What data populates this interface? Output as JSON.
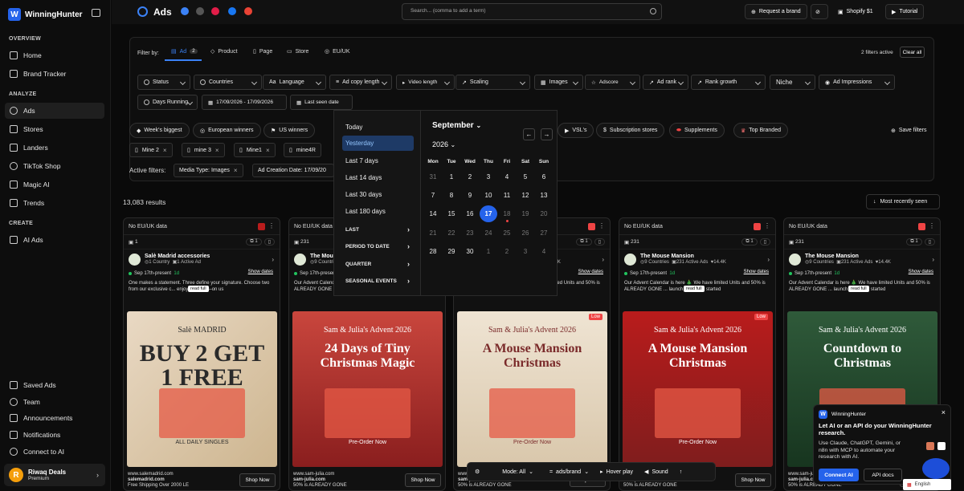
{
  "app": {
    "name": "WinningHunter"
  },
  "sidebar": {
    "overview_label": "OVERVIEW",
    "analyze_label": "ANALYZE",
    "create_label": "CREATE",
    "items": [
      {
        "label": "Home"
      },
      {
        "label": "Brand Tracker"
      },
      {
        "label": "Ads"
      },
      {
        "label": "Stores"
      },
      {
        "label": "Landers"
      },
      {
        "label": "TikTok Shop"
      },
      {
        "label": "Magic AI"
      },
      {
        "label": "Trends"
      },
      {
        "label": "AI Ads"
      }
    ],
    "bottom": [
      {
        "label": "Saved Ads"
      },
      {
        "label": "Team"
      },
      {
        "label": "Announcements"
      },
      {
        "label": "Notifications"
      },
      {
        "label": "Connect to AI"
      }
    ],
    "user": {
      "initial": "R",
      "name": "Riwaq Deals",
      "plan": "Premium"
    }
  },
  "header": {
    "title": "Ads",
    "search_placeholder": "Search... (comma to add a term)",
    "request_brand": "Request a brand",
    "shopify": "Shopify $1",
    "tutorial": "Tutorial"
  },
  "filters": {
    "label": "Filter by:",
    "tabs": [
      {
        "label": "Ad",
        "badge": "2"
      },
      {
        "label": "Product"
      },
      {
        "label": "Page"
      },
      {
        "label": "Store"
      },
      {
        "label": "EU/UK"
      }
    ],
    "active_count": "2 filters active",
    "clear": "Clear all",
    "row1": [
      "Status",
      "Countries",
      "Language",
      "Ad copy length",
      "Video length",
      "Scaling",
      "Images",
      "Adscore",
      "Ad rank",
      "Rank growth",
      "Niche",
      "Ad Impressions"
    ],
    "row2": [
      "Days Running",
      "17/09/2026 - 17/09/2026",
      "Last seen date"
    ],
    "chips": [
      "Week's biggest",
      "European winners",
      "US winners",
      "VSL's",
      "Subscription stores",
      "Supplements",
      "Top Branded"
    ],
    "save": "Save filters",
    "saved": [
      "Mine 2",
      "mine 3",
      "Mine1",
      "mine4R"
    ],
    "active_label": "Active filters:",
    "active": [
      "Media Type: Images",
      "Ad Creation Date: 17/09/20"
    ]
  },
  "results": {
    "count": "13,083 results",
    "sort": "Most recently seen"
  },
  "date_dropdown": {
    "presets": [
      "Today",
      "Yesterday",
      "Last 7 days",
      "Last 14 days",
      "Last 30 days",
      "Last 180 days"
    ],
    "submenus": [
      "LAST",
      "PERIOD TO DATE",
      "QUARTER",
      "SEASONAL EVENTS"
    ],
    "month": "September",
    "year": "2026",
    "weekdays": [
      "Mon",
      "Tue",
      "Wed",
      "Thu",
      "Fri",
      "Sat",
      "Sun"
    ],
    "days": [
      [
        "31",
        "1",
        "2",
        "3",
        "4",
        "5",
        "6"
      ],
      [
        "7",
        "8",
        "9",
        "10",
        "11",
        "12",
        "13"
      ],
      [
        "14",
        "15",
        "16",
        "17",
        "18",
        "19",
        "20"
      ],
      [
        "21",
        "22",
        "23",
        "24",
        "25",
        "26",
        "27"
      ],
      [
        "28",
        "29",
        "30",
        "1",
        "2",
        "3",
        "4"
      ]
    ]
  },
  "cards": [
    {
      "eu": "No EU/UK data",
      "count": "1",
      "adv": "Salè Madrid accessories",
      "sub": "1 Country",
      "sub2": "1 Active Ad",
      "date": "Sep 17th-present",
      "days": "1d",
      "show": "Show dates",
      "desc": "One makes a statement. Three define your signature. Choose two from our exclusive c... enjoy the third—on us",
      "readfull": "read full",
      "site": "www.salemadrid.com",
      "site2": "salemadrid.com",
      "site3": "Free Shipping Over 2000 LE",
      "shop": "Shop Now",
      "low": "",
      "imgtext": "BUY 2 GET 1 FREE",
      "imgsub": "Salè MADRID",
      "imgfoot": "ALL DAILY SINGLES"
    },
    {
      "eu": "No EU/UK data",
      "count": "231",
      "adv": "The Mouse Mansion",
      "sub": "9 Countries",
      "sub2": "231 Active Ads",
      "likes": "14.4K",
      "date": "Sep 17th-present",
      "days": "1d",
      "show": "Show dates",
      "desc": "Our Advent Calendar is here 🎄 We have limited Units and 50% is ALREADY GONE ... launch Party has started",
      "readfull": "read full",
      "site": "www.sam-julia.com",
      "site2": "sam-julia.com",
      "site3": "50% is ALREADY GONE",
      "shop": "Shop Now",
      "low": "",
      "imgtext": "24 Days of Tiny Christmas Magic",
      "imgsub": "Sam & Julia's Advent 2026",
      "imgfoot": "Pre-Order Now"
    },
    {
      "eu": "No EU/UK data",
      "count": "231",
      "adv": "The Mouse Mansion",
      "sub": "9 Countries",
      "sub2": "231 Active Ads",
      "likes": "14.4K",
      "date": "Sep 17th-present",
      "days": "1d",
      "show": "Show dates",
      "desc": "Our Advent Calendar is here 🎄 We have limited Units and 50% is ALREADY GONE ... launch Party has started",
      "readfull": "read full",
      "site": "www.sam-julia.com",
      "site2": "sam-julia.com",
      "site3": "50% is ALREADY GONE",
      "shop": "Shop Now",
      "low": "Low",
      "imgtext": "A Mouse Mansion Christmas",
      "imgsub": "Sam & Julia's Advent 2026",
      "imgfoot": "Pre-Order Now"
    },
    {
      "eu": "No EU/UK data",
      "count": "231",
      "adv": "The Mouse Mansion",
      "sub": "9 Countries",
      "sub2": "231 Active Ads",
      "likes": "14.4K",
      "date": "Sep 17th-present",
      "days": "1d",
      "show": "Show dates",
      "desc": "Our Advent Calendar is here 🎄 We have limited Units and 50% is ALREADY GONE ... launch Party has started",
      "readfull": "read full",
      "site": "www.sam-julia.com",
      "site2": "sam-julia.com",
      "site3": "50% is ALREADY GONE",
      "shop": "Shop Now",
      "low": "Low",
      "imgtext": "A Mouse Mansion Christmas",
      "imgsub": "Sam & Julia's Advent 2026",
      "imgfoot": "Pre-Order Now"
    },
    {
      "eu": "No EU/UK data",
      "count": "231",
      "adv": "The Mouse Mansion",
      "sub": "9 Countries",
      "sub2": "231 Active Ads",
      "likes": "14.4K",
      "date": "Sep 17th-present",
      "days": "1d",
      "show": "Show dates",
      "desc": "Our Advent Calendar is here 🎄 We have limited Units and 50% is ALREADY GONE ... launch Party has started",
      "readfull": "read full",
      "site": "www.sam-julia.com",
      "site2": "sam-julia.com",
      "site3": "50% is ALREADY GONE",
      "shop": "Shop Now",
      "low": "",
      "imgtext": "Countdown to Christmas",
      "imgsub": "Sam & Julia's Advent 2026",
      "imgfoot": "Pre-sale"
    }
  ],
  "bottom_bar": {
    "mode": "Mode: All",
    "per": "ads/brand",
    "hover": "Hover play",
    "sound": "Sound"
  },
  "popup": {
    "brand": "WinningHunter",
    "title": "Let AI or an API do your WinningHunter research.",
    "body": "Use Claude, ChatGPT, Gemini, or n8n with MCP to automate your research with AI.",
    "btn_ai": "Connect AI",
    "btn_api": "API docs"
  },
  "lang": "English",
  "colors": {
    "accent": "#2563eb",
    "low": "#ef4444"
  }
}
